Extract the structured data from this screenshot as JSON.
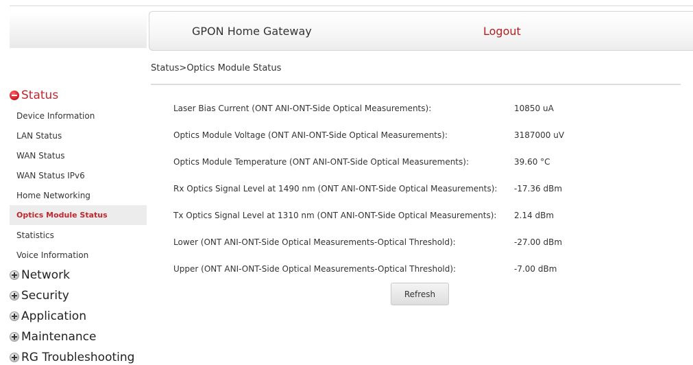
{
  "header": {
    "title": "GPON Home Gateway",
    "logout_label": "Logout"
  },
  "breadcrumb": "Status>Optics Module Status",
  "sidebar": {
    "sections": [
      {
        "label": "Status",
        "expanded": true,
        "icon": "minus-circle-icon"
      },
      {
        "label": "Network",
        "expanded": false,
        "icon": "plus-circle-icon"
      },
      {
        "label": "Security",
        "expanded": false,
        "icon": "plus-circle-icon"
      },
      {
        "label": "Application",
        "expanded": false,
        "icon": "plus-circle-icon"
      },
      {
        "label": "Maintenance",
        "expanded": false,
        "icon": "plus-circle-icon"
      },
      {
        "label": "RG Troubleshooting",
        "expanded": false,
        "icon": "plus-circle-icon"
      }
    ],
    "status_items": [
      "Device Information",
      "LAN Status",
      "WAN Status",
      "WAN Status IPv6",
      "Home Networking",
      "Optics Module Status",
      "Statistics",
      "Voice Information"
    ],
    "active_item": "Optics Module Status"
  },
  "metrics": [
    {
      "label": "Laser Bias Current (ONT ANI-ONT-Side Optical Measurements):",
      "value": "10850 uA"
    },
    {
      "label": "Optics Module Voltage (ONT ANI-ONT-Side Optical Measurements):",
      "value": "3187000 uV"
    },
    {
      "label": "Optics Module Temperature (ONT ANI-ONT-Side Optical Measurements):",
      "value": "39.60 °C"
    },
    {
      "label": "Rx Optics Signal Level at 1490 nm (ONT ANI-ONT-Side Optical Measurements):",
      "value": "-17.36 dBm"
    },
    {
      "label": "Tx Optics Signal Level at 1310 nm (ONT ANI-ONT-Side Optical Measurements):",
      "value": "2.14 dBm"
    },
    {
      "label": "Lower (ONT ANI-ONT-Side Optical Measurements-Optical Threshold):",
      "value": "-27.00 dBm"
    },
    {
      "label": "Upper (ONT ANI-ONT-Side Optical Measurements-Optical Threshold):",
      "value": "-7.00 dBm"
    }
  ],
  "refresh_label": "Refresh",
  "colors": {
    "accent_red": "#c0272d",
    "logout_red": "#b21e1e",
    "active_bg": "#ececec"
  }
}
